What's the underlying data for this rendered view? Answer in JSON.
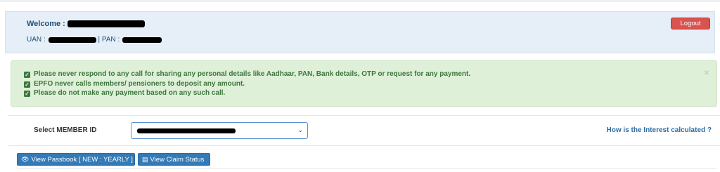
{
  "header": {
    "welcome_label": "Welcome :",
    "uan_label": "UAN :",
    "pan_label": "| PAN :",
    "logout_label": "Logout"
  },
  "alert": {
    "items": [
      "Please never respond to any call for sharing any personal details like Aadhaar, PAN, Bank details, OTP or request for any payment.",
      "EPFO never calls members/ pensioners to deposit any amount.",
      "Please do not make any payment based on any such call."
    ],
    "close_symbol": "×",
    "check_symbol": "✓"
  },
  "member": {
    "label": "Select MEMBER ID",
    "chevron": "⌄",
    "interest_link": "How is the Interest calculated ?"
  },
  "actions": {
    "passbook_label": "View Passbook [ NEW : YEARLY ]",
    "claim_label": "View Claim Status",
    "passbook_icon_glyph": "👁",
    "claim_icon_glyph": "▤"
  },
  "colors": {
    "logout_bg": "#d9534f",
    "alert_bg": "#dff0d8",
    "alert_text": "#3c763d",
    "primary_btn": "#337ab7",
    "welcome_bg": "#e6eff7"
  },
  "icons": {
    "checkbox": "check-square-icon",
    "close": "close-icon",
    "passbook": "eye-icon",
    "claim": "card-icon",
    "select": "chevron-down-icon"
  }
}
